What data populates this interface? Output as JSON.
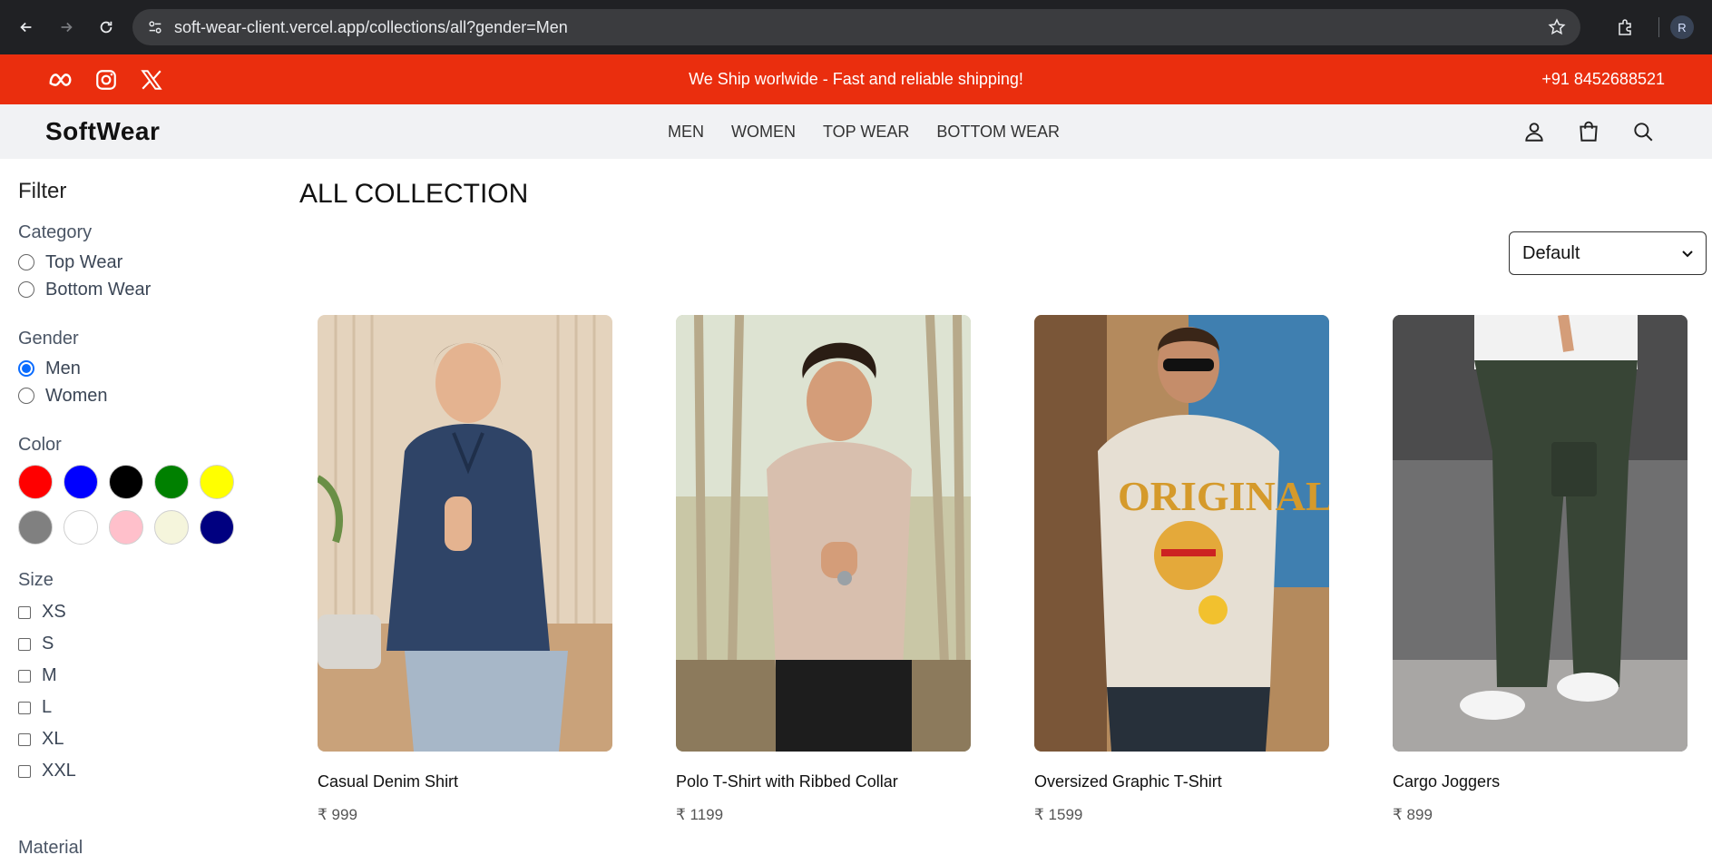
{
  "browser": {
    "url": "soft-wear-client.vercel.app/collections/all?gender=Men",
    "profile_initial": "R"
  },
  "topbar": {
    "announcement": "We Ship worlwide - Fast and reliable shipping!",
    "phone": "+91 8452688521",
    "social_icons": [
      "meta-icon",
      "instagram-icon",
      "x-icon"
    ]
  },
  "header": {
    "logo": "SoftWear",
    "nav": [
      "MEN",
      "WOMEN",
      "TOP WEAR",
      "BOTTOM WEAR"
    ],
    "icons": [
      "user-icon",
      "shopping-bag-icon",
      "search-icon"
    ]
  },
  "filter": {
    "title": "Filter",
    "category": {
      "label": "Category",
      "options": [
        "Top Wear",
        "Bottom Wear"
      ]
    },
    "gender": {
      "label": "Gender",
      "options": [
        "Men",
        "Women"
      ],
      "selected": "Men"
    },
    "color": {
      "label": "Color",
      "swatches": [
        "#ff0000",
        "#0000ff",
        "#000000",
        "#008000",
        "#ffff00",
        "#808080",
        "#ffffff",
        "#ffc0cb",
        "#f5f5dc",
        "#000080"
      ]
    },
    "size": {
      "label": "Size",
      "options": [
        "XS",
        "S",
        "M",
        "L",
        "XL",
        "XXL"
      ]
    },
    "material": {
      "label": "Material"
    }
  },
  "main": {
    "title": "ALL COLLECTION",
    "sort": "Default",
    "products": [
      {
        "name": "Casual Denim Shirt",
        "price": "₹ 999"
      },
      {
        "name": "Polo T-Shirt with Ribbed Collar",
        "price": "₹ 1199"
      },
      {
        "name": "Oversized Graphic T-Shirt",
        "price": "₹ 1599"
      },
      {
        "name": "Cargo Joggers",
        "price": "₹ 899"
      }
    ]
  },
  "colors": {
    "accent": "#ea2e0e",
    "header_bg": "#f1f2f4",
    "radio_selected": "#0a6cff"
  }
}
